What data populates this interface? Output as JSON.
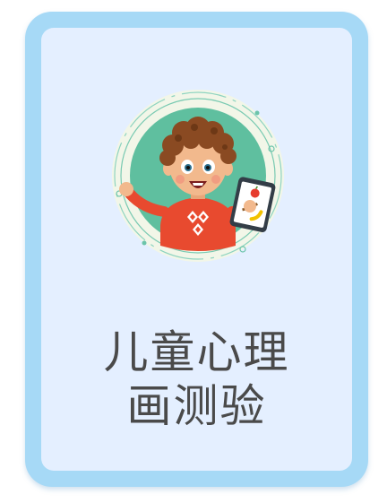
{
  "card": {
    "title_line1": "儿童心理",
    "title_line2": "画测验",
    "illustration_icon": "child-with-tablet-illustration",
    "colors": {
      "frame": "#a6d9f6",
      "panel": "#e4efff",
      "circle": "#5fbf9f",
      "text": "#4a4a4a"
    }
  }
}
